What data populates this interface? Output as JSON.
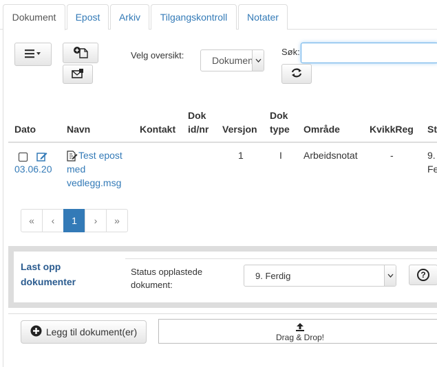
{
  "tabs": [
    {
      "label": "Dokument",
      "active": true
    },
    {
      "label": "Epost"
    },
    {
      "label": "Arkiv"
    },
    {
      "label": "Tilgangskontroll"
    },
    {
      "label": "Notater"
    }
  ],
  "toolbar": {
    "overview_label": "Velg oversikt:",
    "overview_value": "Dokumen",
    "search_label": "Søk:",
    "search_value": ""
  },
  "table": {
    "headers": {
      "dato": "Dato",
      "navn": "Navn",
      "kontakt": "Kontakt",
      "dok_id_1": "Dok",
      "dok_id_2": "id/nr",
      "versjon": "Versjon",
      "dok_type_1": "Dok",
      "dok_type_2": "type",
      "omrade": "Område",
      "kvikkreg": "KvikkReg",
      "status": "St"
    },
    "rows": [
      {
        "date": "03.06.20",
        "name_1": "Test epost",
        "name_2": "med",
        "name_3": "vedlegg.msg",
        "version": "1",
        "type": "I",
        "area": "Arbeidsnotat",
        "kvikkreg": "-",
        "status_1": "9.",
        "status_2": "Fe"
      }
    ]
  },
  "pagination": {
    "first": "«",
    "prev": "‹",
    "current": "1",
    "next": "›",
    "last": "»"
  },
  "upload": {
    "title_1": "Last opp",
    "title_2": "dokumenter",
    "status_label_1": "Status opplastede",
    "status_label_2": "dokument:",
    "status_value": "9. Ferdig",
    "help": "?",
    "add_button": "Legg til dokument(er)",
    "drag_drop": "Drag & Drop!"
  },
  "colors": {
    "link": "#337ab7",
    "accent": "#337ab7",
    "border": "#dddddd"
  }
}
